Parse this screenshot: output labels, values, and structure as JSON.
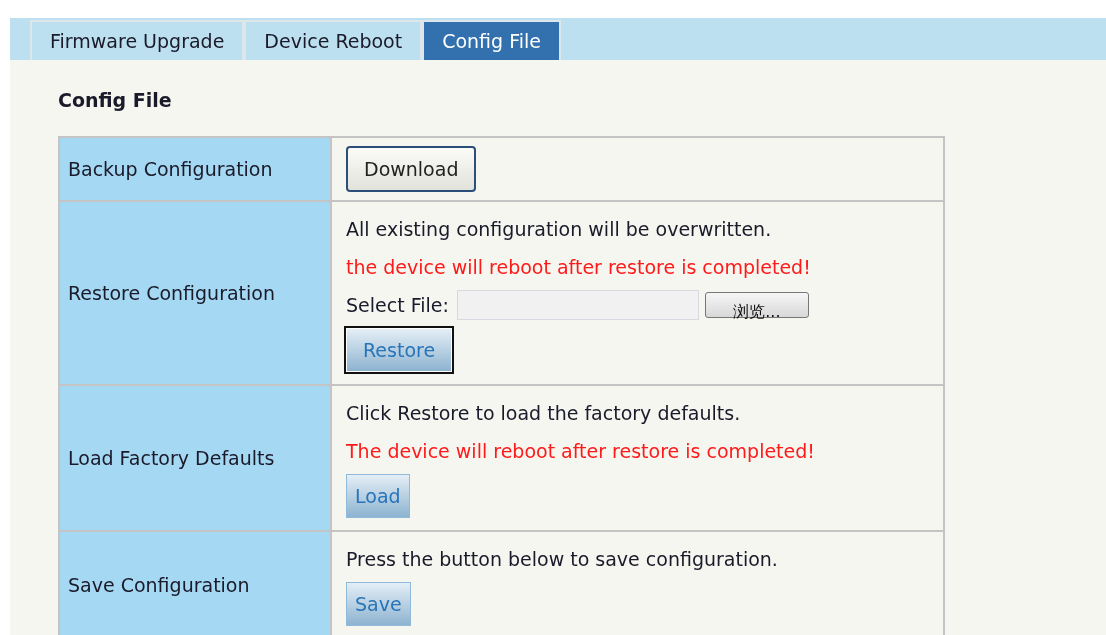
{
  "tabs": [
    {
      "label": "Firmware Upgrade",
      "selected": false
    },
    {
      "label": "Device Reboot",
      "selected": false
    },
    {
      "label": "Config File",
      "selected": true
    }
  ],
  "section_title": "Config File",
  "rows": [
    {
      "label": "Backup Configuration",
      "items": [
        {
          "kind": "system-button",
          "label": "Download"
        }
      ]
    },
    {
      "label": "Restore Configuration",
      "items": [
        {
          "kind": "text",
          "text": "All existing configuration will be overwritten."
        },
        {
          "kind": "warning",
          "text": "the device will reboot after restore is completed!"
        },
        {
          "kind": "file",
          "label": "Select File:",
          "button": "浏览..."
        },
        {
          "kind": "button",
          "label": "Restore",
          "focused": true
        }
      ]
    },
    {
      "label": "Load Factory Defaults",
      "items": [
        {
          "kind": "text",
          "text": "Click Restore to load the factory defaults."
        },
        {
          "kind": "warning",
          "text": "The device will reboot after restore is completed!"
        },
        {
          "kind": "button",
          "label": "Load",
          "focused": false
        }
      ]
    },
    {
      "label": "Save Configuration",
      "items": [
        {
          "kind": "text",
          "text": "Press the button below to save configuration."
        },
        {
          "kind": "button",
          "label": "Save",
          "focused": false
        }
      ]
    }
  ]
}
